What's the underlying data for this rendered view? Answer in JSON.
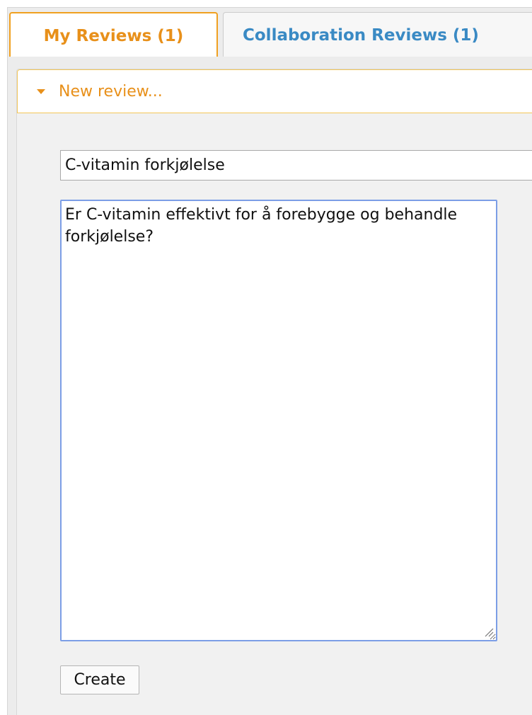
{
  "tabs": [
    {
      "label": "My Reviews (1)",
      "active": true
    },
    {
      "label": "Collaboration Reviews (1)",
      "active": false
    }
  ],
  "new_review": {
    "header": "New review...",
    "title_value": "C-vitamin forkjølelse",
    "description_value": "Er C-vitamin effektivt for å forebygge og behandle forkjølelse?",
    "create_label": "Create"
  },
  "colors": {
    "accent_orange": "#e8901a",
    "link_blue": "#3a8ac4",
    "focus_blue": "#7c9ee6",
    "header_border": "#f3c658"
  },
  "icons": {
    "section_toggle": "caret-down-icon",
    "textarea_resize": "resize-grip-icon"
  }
}
